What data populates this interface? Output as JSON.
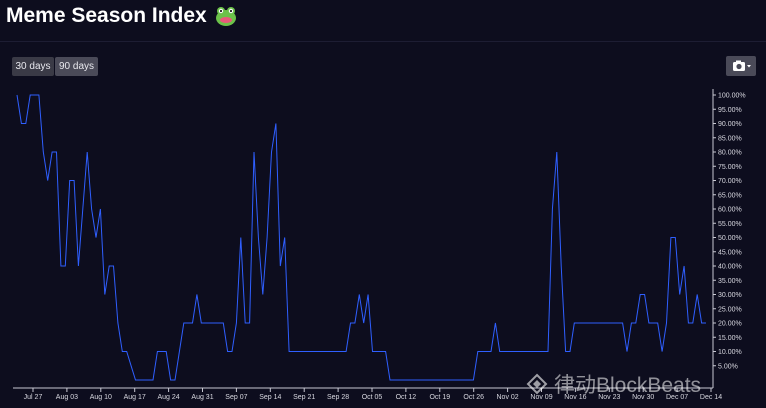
{
  "page": {
    "title": "Meme Season Index",
    "buttons": [
      "30 days",
      "90 days"
    ],
    "watermark": "律动BlockBeats"
  },
  "icons": {
    "title_emoji": "frog-emoji-icon",
    "export": "camera-icon",
    "watermark_logo": "diamond-logo-icon"
  },
  "colors": {
    "line": "#2f5fff",
    "background": "#0d0d1e"
  },
  "chart_data": {
    "type": "line",
    "title": "Meme Season Index",
    "grid": false,
    "y_axis_side": "right",
    "ylim": [
      0,
      100
    ],
    "y_ticks": [
      "100.00%",
      "95.00%",
      "90.00%",
      "85.00%",
      "80.00%",
      "75.00%",
      "70.00%",
      "65.00%",
      "60.00%",
      "55.00%",
      "50.00%",
      "45.00%",
      "40.00%",
      "35.00%",
      "30.00%",
      "25.00%",
      "20.00%",
      "15.00%",
      "10.00%",
      "5.00%"
    ],
    "x_ticks": [
      "Jul 27",
      "Aug 03",
      "Aug 10",
      "Aug 17",
      "Aug 24",
      "Aug 31",
      "Sep 07",
      "Sep 14",
      "Sep 21",
      "Sep 28",
      "Oct 05",
      "Oct 12",
      "Oct 19",
      "Oct 26",
      "Nov 02",
      "Nov 09",
      "Nov 16",
      "Nov 23",
      "Nov 30",
      "Dec 07",
      "Dec 14"
    ],
    "series": [
      {
        "values": [
          100,
          90,
          90,
          100,
          100,
          100,
          80,
          70,
          80,
          80,
          40,
          40,
          70,
          70,
          40,
          60,
          80,
          60,
          50,
          60,
          30,
          40,
          40,
          20,
          10,
          10,
          5,
          0,
          0,
          0,
          0,
          0,
          10,
          10,
          10,
          0,
          0,
          10,
          20,
          20,
          20,
          30,
          20,
          20,
          20,
          20,
          20,
          20,
          10,
          10,
          20,
          50,
          20,
          20,
          80,
          50,
          30,
          50,
          80,
          90,
          40,
          50,
          10,
          10,
          10,
          10,
          10,
          10,
          10,
          10,
          10,
          10,
          10,
          10,
          10,
          10,
          20,
          20,
          30,
          20,
          30,
          10,
          10,
          10,
          10,
          0,
          0,
          0,
          0,
          0,
          0,
          0,
          0,
          0,
          0,
          0,
          0,
          0,
          0,
          0,
          0,
          0,
          0,
          0,
          0,
          10,
          10,
          10,
          10,
          20,
          10,
          10,
          10,
          10,
          10,
          10,
          10,
          10,
          10,
          10,
          10,
          10,
          60,
          80,
          40,
          10,
          10,
          20,
          20,
          20,
          20,
          20,
          20,
          20,
          20,
          20,
          20,
          20,
          20,
          10,
          20,
          20,
          30,
          30,
          20,
          20,
          20,
          10,
          20,
          50,
          50,
          30,
          40,
          20,
          20,
          30,
          20,
          20
        ]
      }
    ]
  }
}
